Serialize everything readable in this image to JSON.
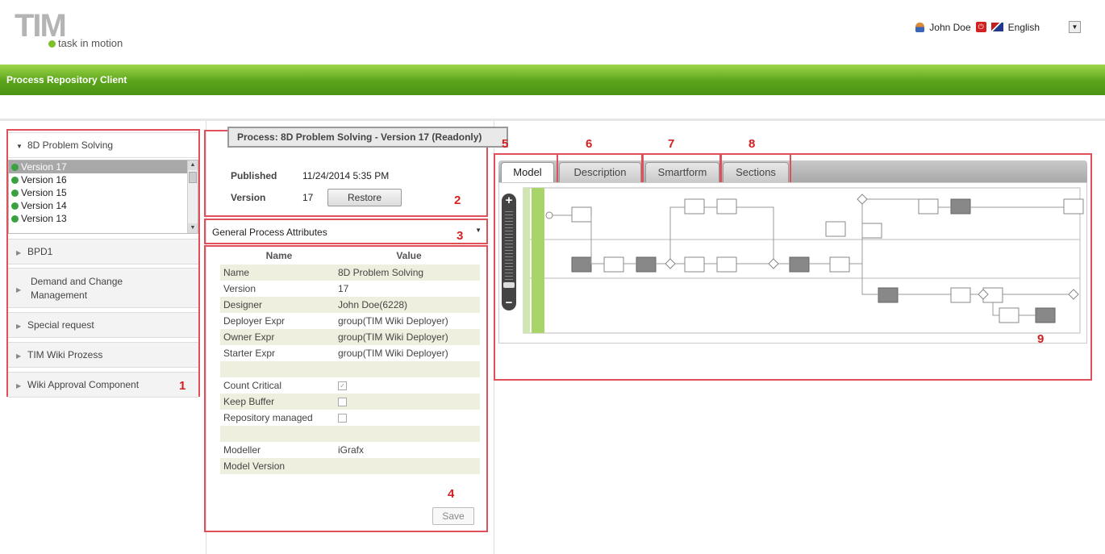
{
  "header": {
    "logo_main": "TIM",
    "logo_tagline": "task in motion",
    "user_name": "John Doe",
    "language": "English"
  },
  "appbar": {
    "title": "Process Repository Client"
  },
  "left": {
    "expanded_group": "8D Problem Solving",
    "versions": [
      "Version 17",
      "Version 16",
      "Version 15",
      "Version 14",
      "Version 13"
    ],
    "groups": [
      "BPD1",
      "Demand and Change Management",
      "Special request",
      "TIM Wiki Prozess",
      "Wiki Approval Component"
    ]
  },
  "middle": {
    "process_title": "Process: 8D Problem Solving - Version 17 (Readonly)",
    "published_label": "Published",
    "published_value": "11/24/2014 5:35 PM",
    "version_label": "Version",
    "version_value": "17",
    "restore_label": "Restore",
    "attributes_select": "General Process Attributes",
    "table_headers": {
      "name": "Name",
      "value": "Value"
    },
    "properties": [
      {
        "name": "Name",
        "value": "8D Problem Solving"
      },
      {
        "name": "Version",
        "value": "17"
      },
      {
        "name": "Designer",
        "value": "John Doe(6228)"
      },
      {
        "name": "Deployer Expr",
        "value": "group(TIM Wiki Deployer)"
      },
      {
        "name": "Owner Expr",
        "value": "group(TIM Wiki Deployer)"
      },
      {
        "name": "Starter Expr",
        "value": "group(TIM Wiki Deployer)"
      },
      {
        "name": "",
        "value": ""
      },
      {
        "name": "Count Critical",
        "value": "",
        "checkbox": true,
        "checked": true
      },
      {
        "name": "Keep Buffer",
        "value": "",
        "checkbox": true,
        "checked": false
      },
      {
        "name": "Repository managed",
        "value": "",
        "checkbox": true,
        "checked": false
      },
      {
        "name": "",
        "value": ""
      },
      {
        "name": "Modeller",
        "value": "iGrafx"
      },
      {
        "name": "Model Version",
        "value": ""
      },
      {
        "name": "",
        "value": ""
      }
    ],
    "save_label": "Save"
  },
  "right": {
    "tabs": [
      "Model",
      "Description",
      "Smartform",
      "Sections"
    ],
    "active_tab": "Model"
  },
  "callouts": [
    "1",
    "2",
    "3",
    "4",
    "5",
    "6",
    "7",
    "8",
    "9"
  ],
  "colors": {
    "green": "#5aa41a",
    "callout_red": "#e0505a",
    "selected": "#a8a8a8"
  }
}
